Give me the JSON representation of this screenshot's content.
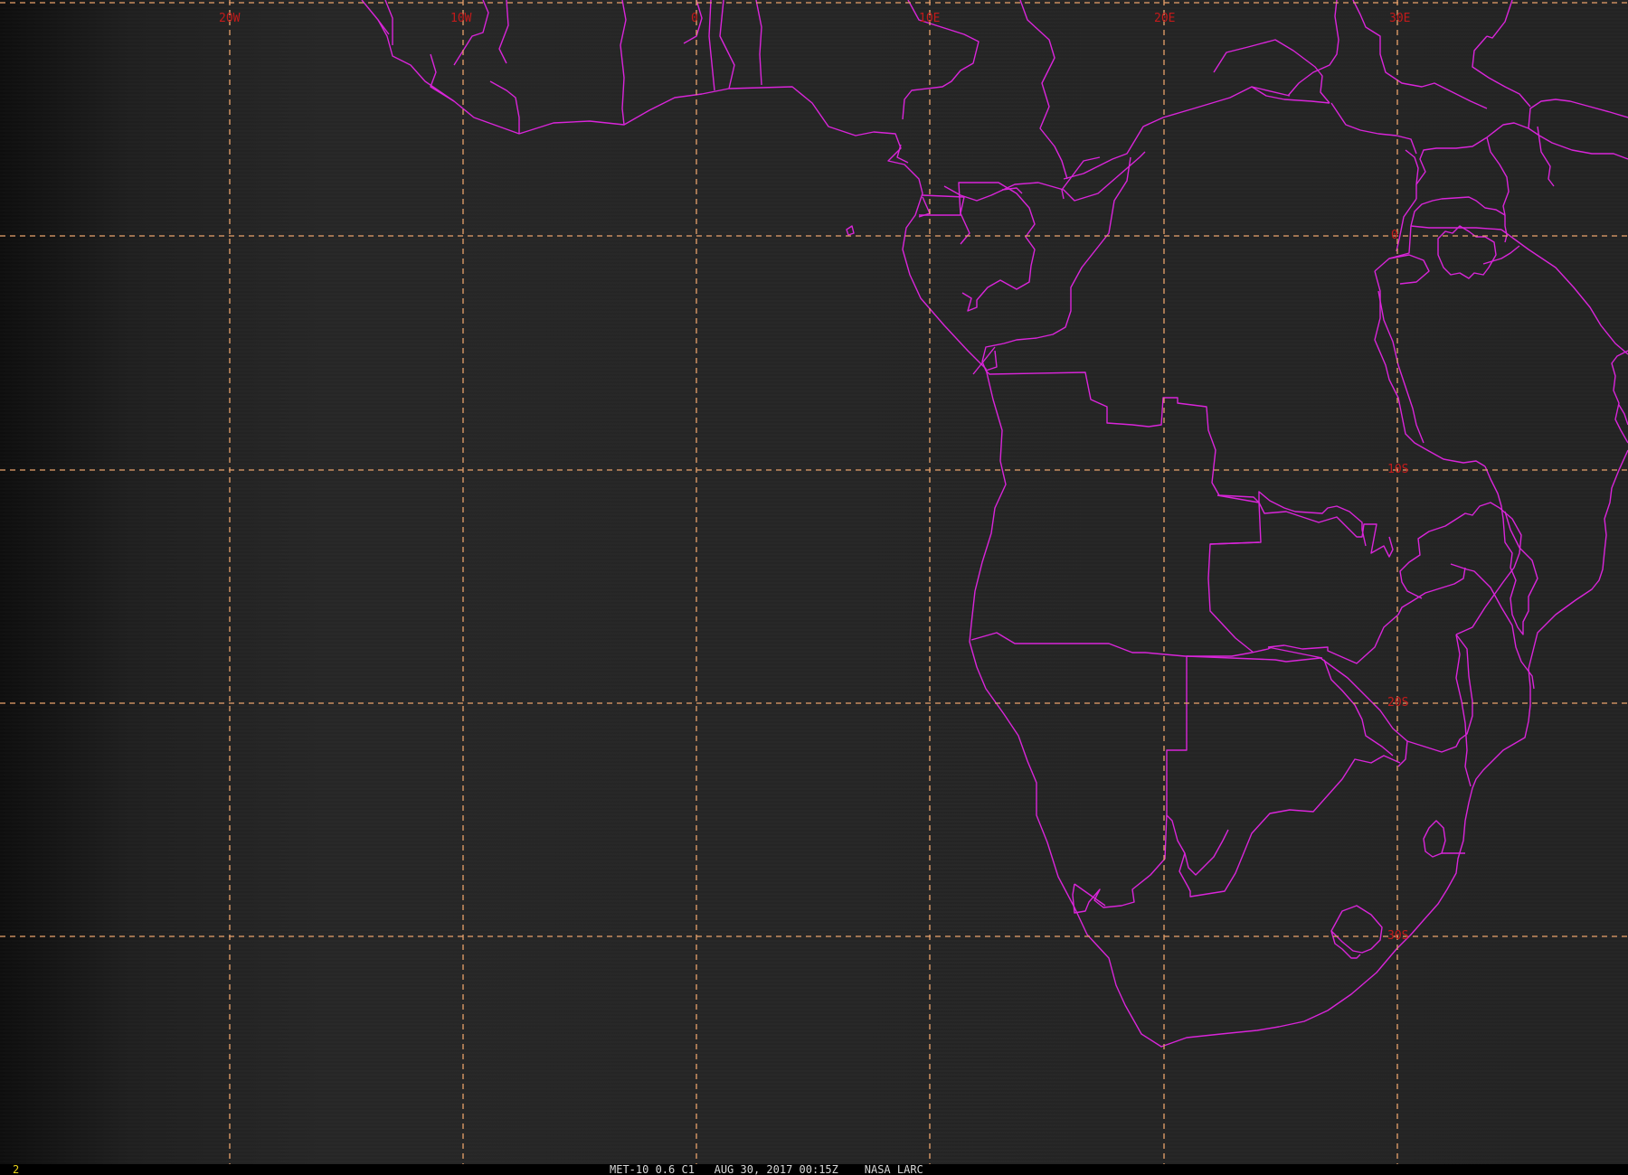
{
  "colors": {
    "background": "#232323",
    "grid": "#e9a26b",
    "borders": "#d925d9",
    "labels": "#c41a1a",
    "status_text": "#d8d8d8",
    "frame_number": "#e8d21a"
  },
  "grid": {
    "longitude_labels": [
      "20W",
      "10W",
      "0",
      "10E",
      "20E",
      "30E"
    ],
    "latitude_labels": [
      "0",
      "10S",
      "20S",
      "30S"
    ]
  },
  "status_bar": {
    "frame_number": "2",
    "caption": "MET-10 0.6 C1   AUG 30, 2017 00:15Z    NASA LARC"
  }
}
